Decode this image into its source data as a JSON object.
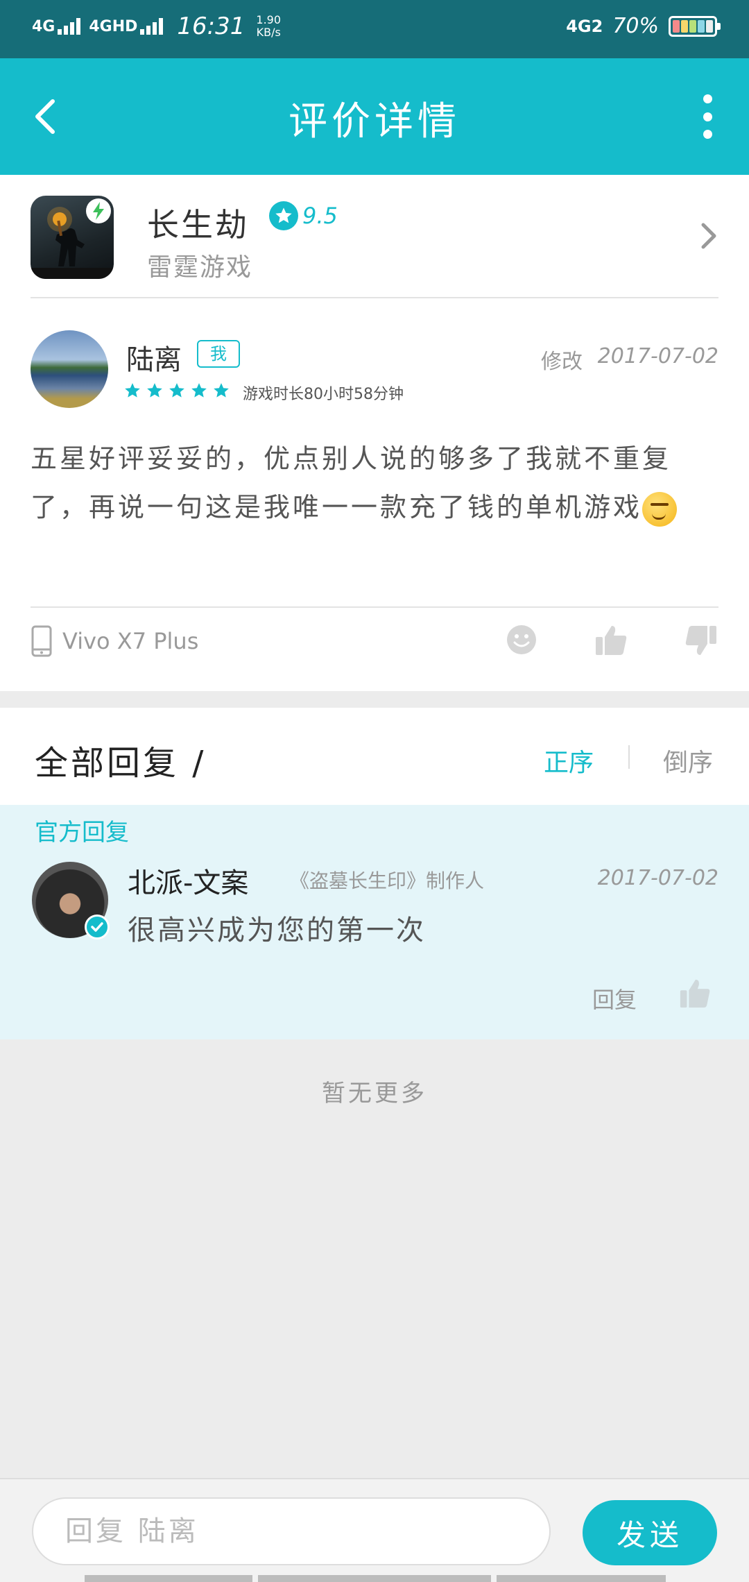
{
  "status_bar": {
    "signal1": "4G",
    "signal2": "4GHD",
    "time": "16:31",
    "speed_value": "1.90",
    "speed_unit": "KB/s",
    "network": "4G2",
    "battery": "70%"
  },
  "header": {
    "title": "评价详情"
  },
  "app": {
    "name": "长生劫",
    "score": "9.5",
    "developer": "雷霆游戏"
  },
  "review": {
    "author": "陆离",
    "me_tag": "我",
    "rating": 5,
    "playtime": "游戏时长80小时58分钟",
    "edit_label": "修改",
    "date": "2017-07-02",
    "text": "五星好评妥妥的，优点别人说的够多了我就不重复了，再说一句这是我唯一一款充了钱的单机游戏",
    "device": "Vivo X7 Plus"
  },
  "replies": {
    "title": "全部回复 /",
    "sort_asc": "正序",
    "sort_desc": "倒序"
  },
  "official_reply": {
    "label": "官方回复",
    "author": "北派-文案",
    "role": "《盗墓长生印》制作人",
    "date": "2017-07-02",
    "text": "很高兴成为您的第一次",
    "reply_label": "回复"
  },
  "no_more": "暂无更多",
  "composer": {
    "placeholder": "回复 陆离",
    "send_label": "发送"
  },
  "colors": {
    "accent": "#15bccb",
    "status_bar": "#166d78"
  }
}
